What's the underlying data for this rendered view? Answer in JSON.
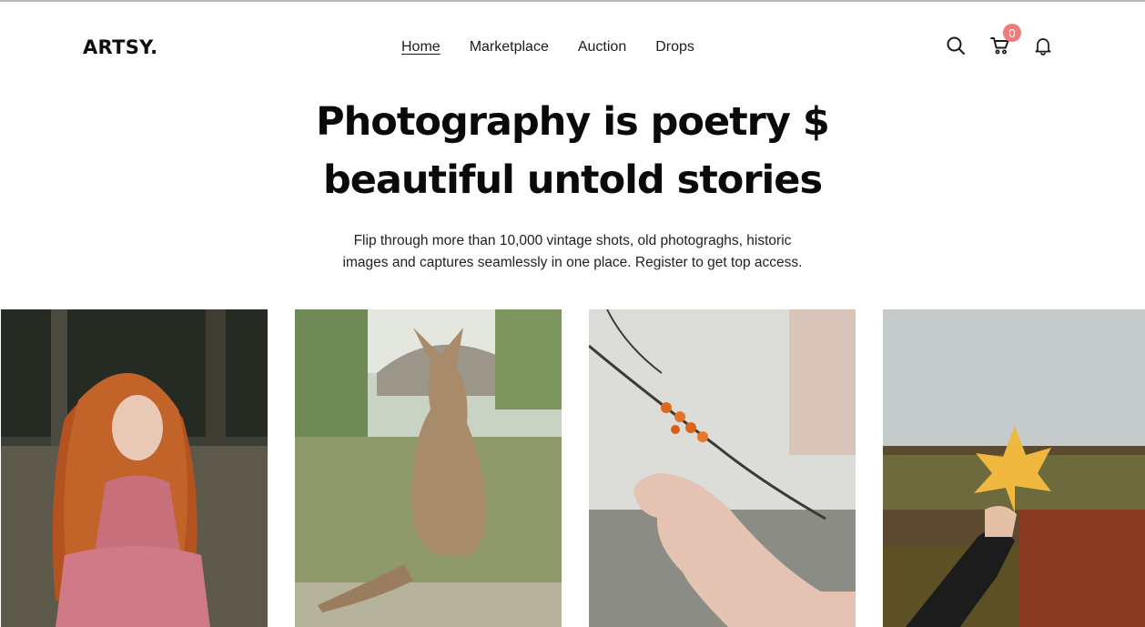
{
  "brand": {
    "logo": "ARTSY."
  },
  "nav": {
    "items": [
      {
        "label": "Home",
        "active": true
      },
      {
        "label": "Marketplace",
        "active": false
      },
      {
        "label": "Auction",
        "active": false
      },
      {
        "label": "Drops",
        "active": false
      }
    ]
  },
  "header_icons": {
    "search": "search-icon",
    "cart": "cart-icon",
    "cart_count": "0",
    "notifications": "bell-icon"
  },
  "hero": {
    "title_line1": "Photography is poetry $",
    "title_line2": "beautiful untold stories",
    "subtitle_line1": "Flip through more than 10,000 vintage shots, old photograghs, historic",
    "subtitle_line2": "images and captures seamlessly in one place. Register to get top access."
  },
  "gallery": {
    "photos": [
      {
        "subject": "woman-red-curly-hair"
      },
      {
        "subject": "kangaroo"
      },
      {
        "subject": "hand-with-berry-branch"
      },
      {
        "subject": "hand-holding-maple-leaf"
      }
    ]
  },
  "colors": {
    "text": "#0a0a0a",
    "badge": "#f07a7a",
    "background": "#ffffff"
  }
}
